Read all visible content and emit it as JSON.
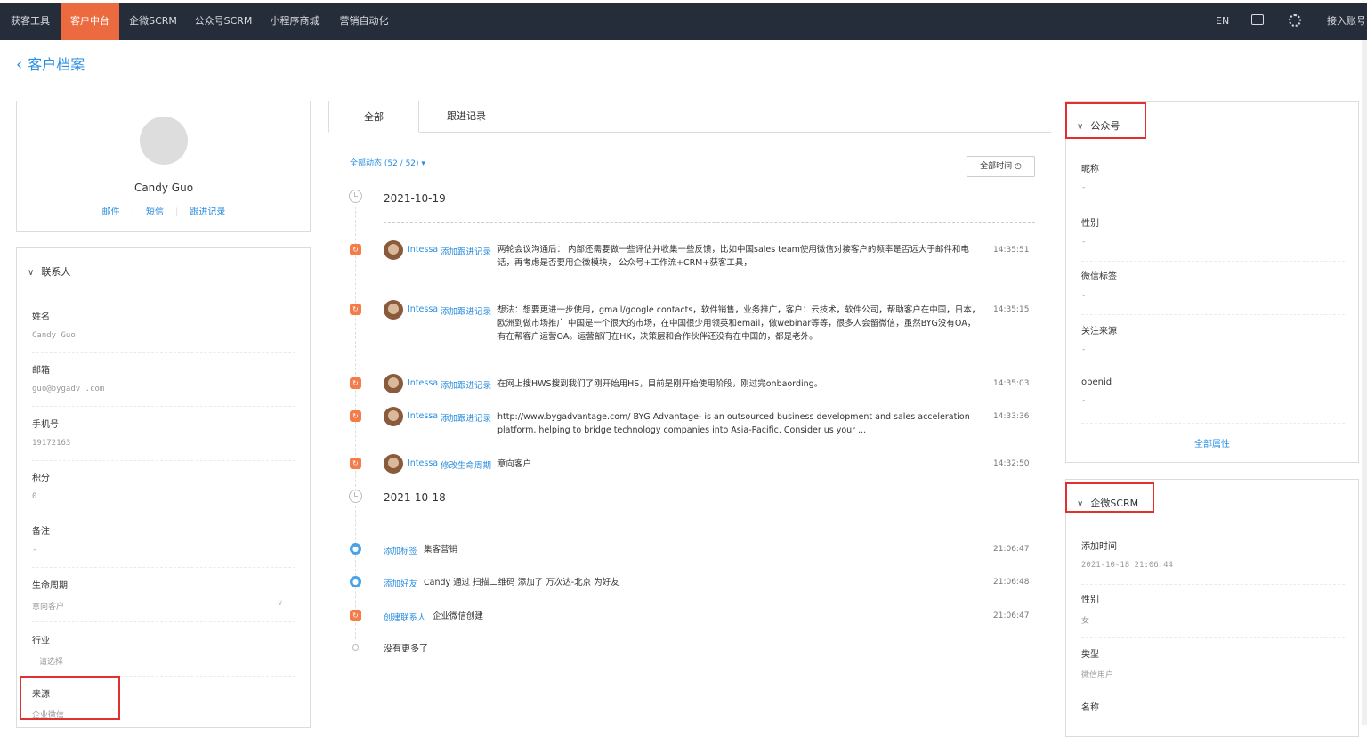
{
  "topnav": {
    "items": [
      "获客工具",
      "客户中台",
      "企微SCRM",
      "公众号SCRM",
      "小程序商城",
      "营销自动化"
    ],
    "active": "客户中台",
    "lang": "EN",
    "account": "接入账号"
  },
  "page": {
    "title": "客户档案"
  },
  "profile": {
    "name": "Candy Guo",
    "links": [
      "邮件",
      "短信",
      "跟进记录"
    ]
  },
  "contact": {
    "section_title": "联系人",
    "fields": [
      {
        "label": "姓名",
        "value": "Candy  Guo"
      },
      {
        "label": "邮箱",
        "value": "guo@bygadv          .com"
      },
      {
        "label": "手机号",
        "value": "19172163"
      },
      {
        "label": "积分",
        "value": "0"
      },
      {
        "label": "备注",
        "value": "-"
      },
      {
        "label": "生命周期",
        "value": "意向客户"
      },
      {
        "label": "行业",
        "value": "请选择"
      },
      {
        "label": "来源",
        "value": "企业微信"
      }
    ]
  },
  "tabs": [
    "全部",
    "跟进记录"
  ],
  "filter": {
    "label": "全部动态 (52 / 52)",
    "time_button": "全部时间"
  },
  "timeline": {
    "day1": {
      "date": "2021-10-19",
      "events": [
        {
          "user": "Intessa",
          "action": "添加跟进记录",
          "text": "两轮会议沟通后： 内部还需要做一些评估并收集一些反馈，比如中国sales team使用微信对接客户的频率是否远大于邮件和电话，再考虑是否要用企微模块， 公众号+工作流+CRM+获客工具，",
          "time": "14:35:51"
        },
        {
          "user": "Intessa",
          "action": "添加跟进记录",
          "text": "想法：想要更进一步使用，gmail/google contacts，软件销售，业务推广，客户：云技术，软件公司，帮助客户在中国，日本，欧洲到做市场推广 中国是一个很大的市场，在中国很少用领英和email，做webinar等等，很多人会留微信，虽然BYG没有OA，有在帮客户运营OA。运营部门在HK，决策层和合作伙伴还没有在中国的，都是老外。",
          "time": "14:35:15"
        },
        {
          "user": "Intessa",
          "action": "添加跟进记录",
          "text": "在网上搜HWS搜到我们了刚开始用HS，目前是刚开始使用阶段，刚过完onbaording。",
          "time": "14:35:03"
        },
        {
          "user": "Intessa",
          "action": "添加跟进记录",
          "text": "http://www.bygadvantage.com/ BYG Advantage- is an outsourced business development and sales acceleration platform, helping to bridge technology companies into Asia-Pacific. Consider us your ...",
          "time": "14:33:36"
        },
        {
          "user": "Intessa",
          "action": "修改生命周期",
          "text": "意向客户",
          "time": "14:32:50"
        }
      ]
    },
    "day2": {
      "date": "2021-10-18",
      "events": [
        {
          "action": "添加标签",
          "text": "集客营销",
          "time": "21:06:47"
        },
        {
          "action": "添加好友",
          "text": "Candy 通过 扫描二维码 添加了 万次达-北京 为好友",
          "time": "21:06:48"
        },
        {
          "action": "创建联系人",
          "text": "企业微信创建",
          "time": "21:06:47"
        }
      ]
    },
    "end": "没有更多了"
  },
  "wechat_oa": {
    "title": "公众号",
    "fields": [
      {
        "label": "昵称",
        "value": "-"
      },
      {
        "label": "性别",
        "value": "-"
      },
      {
        "label": "微信标签",
        "value": "-"
      },
      {
        "label": "关注来源",
        "value": "-"
      },
      {
        "label": "openid",
        "value": "-"
      }
    ],
    "all_attrs": "全部属性"
  },
  "wecom": {
    "title": "企微SCRM",
    "fields": [
      {
        "label": "添加时间",
        "value": "2021-10-18 21:06:44"
      },
      {
        "label": "性别",
        "value": "女"
      },
      {
        "label": "类型",
        "value": "微信用户"
      },
      {
        "label": "名称",
        "value": ""
      }
    ]
  },
  "colors": {
    "nav_bg": "#262d3a",
    "accent": "#ec6a3f",
    "link": "#2a8ee0",
    "highlight": "#e03030"
  }
}
